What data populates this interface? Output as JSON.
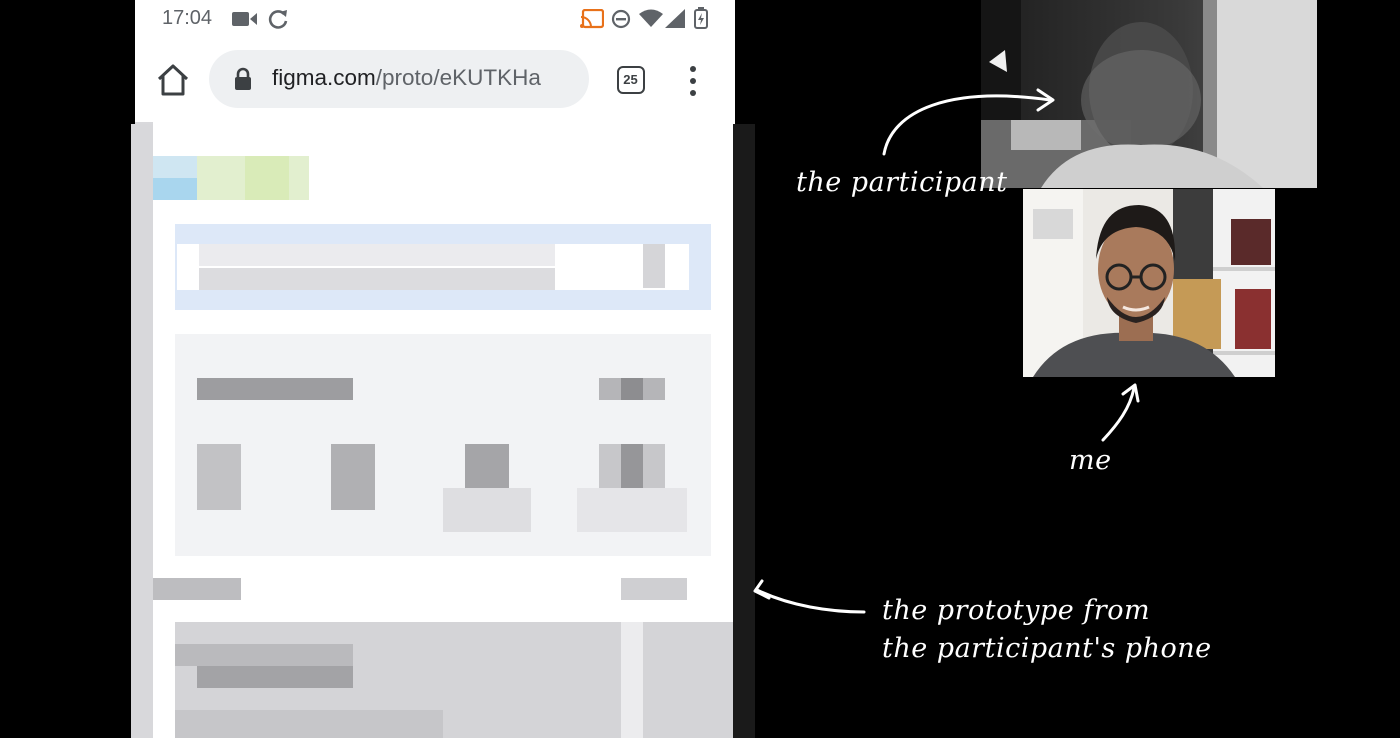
{
  "status_bar": {
    "time": "17:04"
  },
  "browser": {
    "url_domain": "figma.com",
    "url_path": "/proto/eKUTKHa",
    "tab_count": "25"
  },
  "annotations": {
    "participant": "the participant",
    "me": "me",
    "prototype_line1": "the prototype from",
    "prototype_line2": "the participant's phone"
  },
  "colors": {
    "background": "#000000",
    "annotation_text": "#ffffff",
    "url_bar": "#eef0f2"
  }
}
